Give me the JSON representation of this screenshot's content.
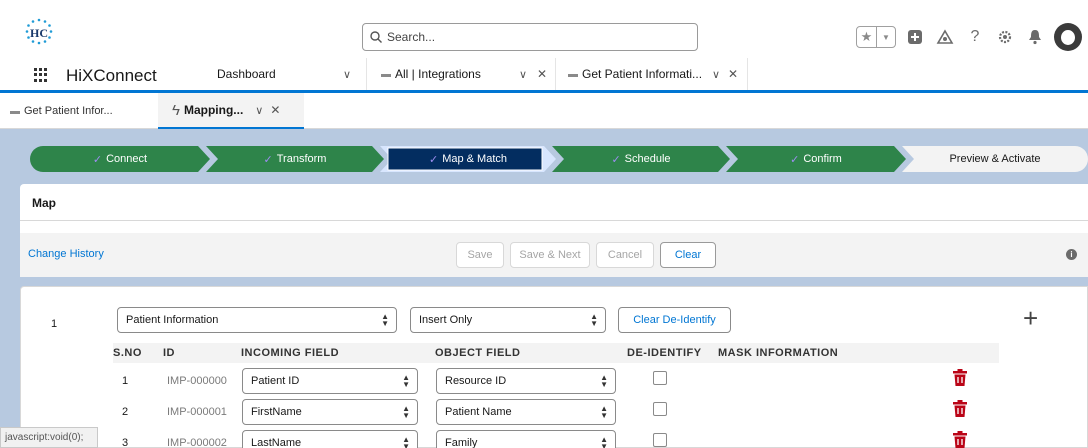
{
  "global_header": {
    "logo_text": "HC",
    "search": {
      "placeholder": "Search..."
    }
  },
  "nav": {
    "app_name": "HiXConnect",
    "tabs": [
      {
        "label": "Dashboard"
      },
      {
        "label": "All | Integrations"
      },
      {
        "label": "Get Patient Informati..."
      }
    ]
  },
  "subtabs": [
    {
      "label": "Get Patient Infor..."
    },
    {
      "label": "Mapping..."
    }
  ],
  "path": {
    "steps": [
      {
        "label": "Connect",
        "state": "complete"
      },
      {
        "label": "Transform",
        "state": "complete"
      },
      {
        "label": "Map & Match",
        "state": "current"
      },
      {
        "label": "Schedule",
        "state": "complete"
      },
      {
        "label": "Confirm",
        "state": "complete"
      },
      {
        "label": "Preview & Activate",
        "state": "incomplete"
      }
    ],
    "colors": {
      "complete": "#2e844a",
      "current": "#032d60",
      "incomplete": "#f3f3f3"
    }
  },
  "map_tab": {
    "title": "Map"
  },
  "actions": {
    "change_history": "Change History",
    "save": "Save",
    "save_next": "Save & Next",
    "cancel": "Cancel",
    "clear": "Clear"
  },
  "mapping_group": {
    "index": "1",
    "object": "Patient Information",
    "operation": "Insert Only",
    "clear_deidentify": "Clear De-Identify",
    "columns": {
      "sno": "S.NO",
      "id": "ID",
      "incoming": "INCOMING FIELD",
      "object": "OBJECT FIELD",
      "deidentify": "DE-IDENTIFY",
      "mask": "MASK INFORMATION"
    },
    "rows": [
      {
        "sno": "1",
        "id": "IMP-000000",
        "incoming": "Patient ID",
        "object": "Resource ID",
        "deidentify": false
      },
      {
        "sno": "2",
        "id": "IMP-000001",
        "incoming": "FirstName",
        "object": "Patient Name",
        "deidentify": false
      },
      {
        "sno": "3",
        "id": "IMP-000002",
        "incoming": "LastName",
        "object": "Family",
        "deidentify": false
      }
    ]
  },
  "status_bar": {
    "text": "javascript:void(0);"
  },
  "colors": {
    "brand_blue": "#0176d3",
    "delete_red": "#ba0517"
  }
}
